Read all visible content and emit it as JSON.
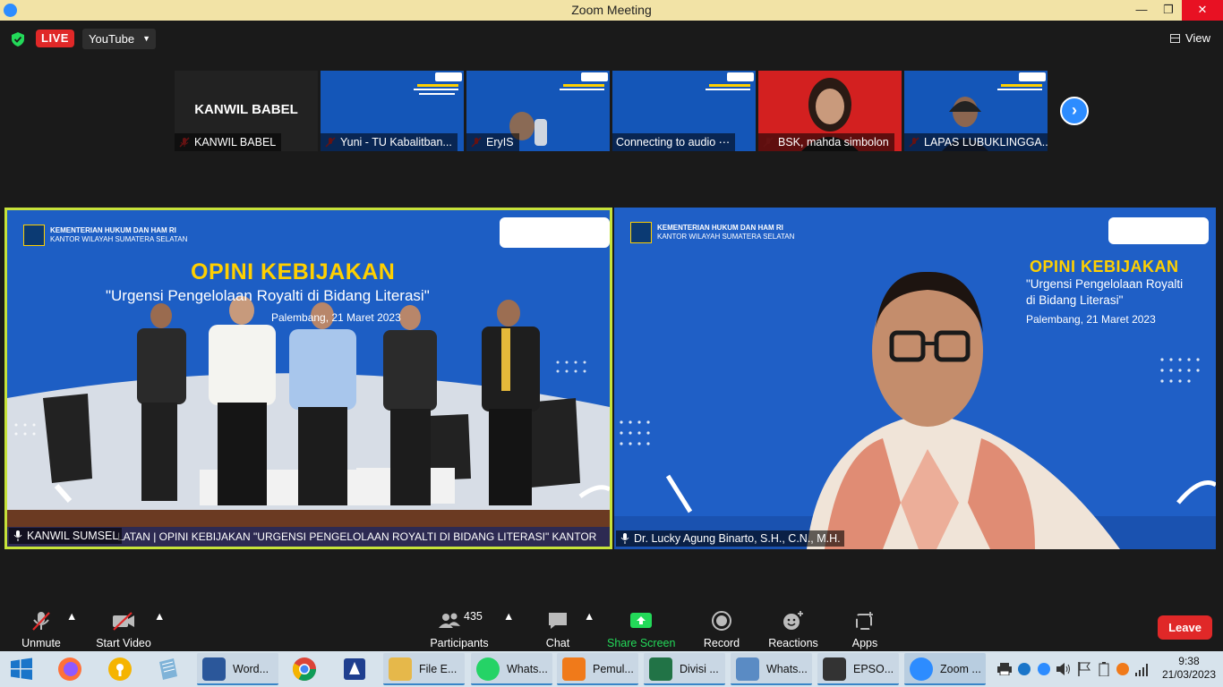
{
  "window": {
    "title": "Zoom Meeting",
    "min_glyph": "—",
    "max_glyph": "❐",
    "close_glyph": "✕"
  },
  "topbar": {
    "live_label": "LIVE",
    "stream_label": "YouTube",
    "view_label": "View"
  },
  "thumbnails": [
    {
      "name": "KANWIL BABEL",
      "overlay_text": "KANWIL BABEL",
      "muted": true
    },
    {
      "name": "Yuni - TU Kabalitban...",
      "muted": true
    },
    {
      "name": "EryIS",
      "muted": true
    },
    {
      "name": "Connecting to audio ⋯",
      "muted": false
    },
    {
      "name": "BSK, mahda simbolon",
      "muted": true
    },
    {
      "name": "LAPAS LUBUKLINGGA...",
      "muted": true
    }
  ],
  "main_videos": {
    "left": {
      "participant": "KANWIL SUMSEL",
      "header_line1": "KEMENTERIAN HUKUM DAN HAM RI",
      "header_line2": "KANTOR WILAYAH SUMATERA SELATAN",
      "title": "OPINI KEBIJAKAN",
      "subtitle": "\"Urgensi Pengelolaan Royalti di Bidang Literasi\"",
      "date": "Palembang, 21 Maret 2023",
      "ticker": "LATAN | OPINI KEBIJAKAN \"URGENSI PENGELOLAAN ROYALTI DI BIDANG LITERASI\" KANTOR"
    },
    "right": {
      "participant": "Dr. Lucky Agung Binarto, S.H., C.N., M.H.",
      "header_line1": "KEMENTERIAN HUKUM DAN HAM RI",
      "header_line2": "KANTOR WILAYAH SUMATERA SELATAN",
      "title": "OPINI KEBIJAKAN",
      "subtitle_line1": "\"Urgensi Pengelolaan Royalti",
      "subtitle_line2": "di Bidang Literasi\"",
      "date": "Palembang, 21 Maret 2023"
    }
  },
  "toolbar": {
    "unmute": "Unmute",
    "start_video": "Start Video",
    "participants": "Participants",
    "participants_count": "435",
    "chat": "Chat",
    "share_screen": "Share Screen",
    "record": "Record",
    "reactions": "Reactions",
    "apps": "Apps",
    "leave": "Leave"
  },
  "taskbar": {
    "apps": [
      {
        "label": "Word...",
        "icon": "word-icon",
        "color": "#2b579a"
      },
      {
        "label": "File E...",
        "icon": "file-explorer-icon",
        "color": "#e6b84a"
      },
      {
        "label": "Whats...",
        "icon": "chrome-whatsapp-icon",
        "color": "#25d366"
      },
      {
        "label": "Pemul...",
        "icon": "pdf-icon",
        "color": "#f07a1a"
      },
      {
        "label": "Divisi ...",
        "icon": "excel-icon",
        "color": "#217346"
      },
      {
        "label": "Whats...",
        "icon": "photo-icon",
        "color": "#5a8bc4"
      },
      {
        "label": "EPSO...",
        "icon": "printer-icon",
        "color": "#333333"
      },
      {
        "label": "Zoom ...",
        "icon": "zoom-icon",
        "color": "#2d8cff"
      }
    ],
    "time": "9:38",
    "date": "21/03/2023"
  },
  "colors": {
    "accent": "#2d8cff",
    "live_red": "#e02828",
    "active_border": "#c6e23a",
    "share_green": "#23d959"
  }
}
